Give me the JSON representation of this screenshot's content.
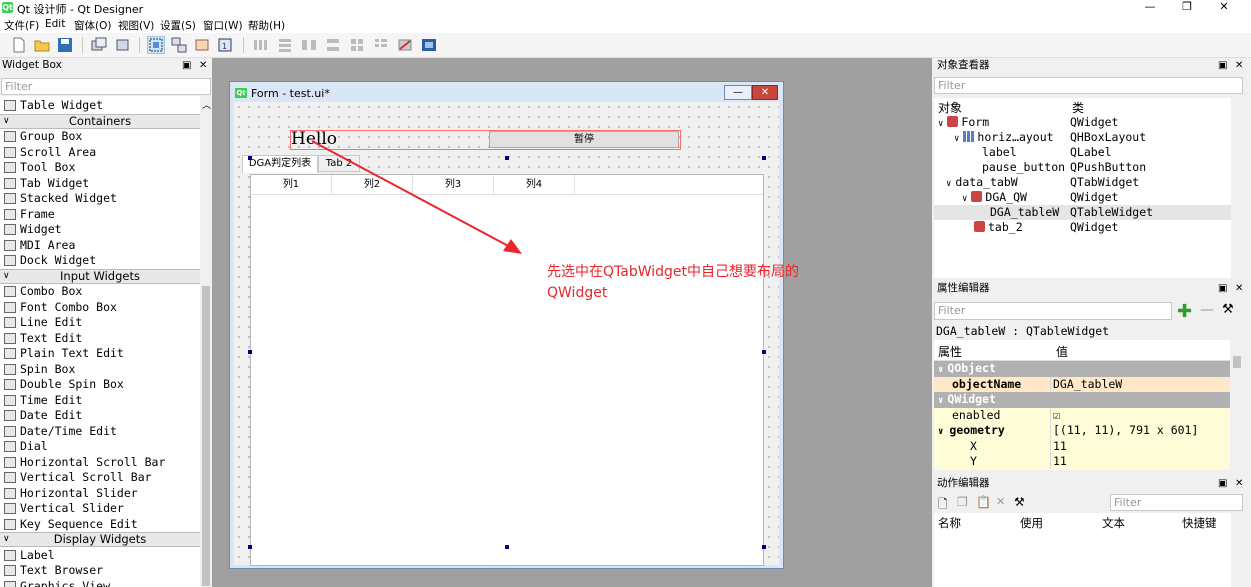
{
  "window": {
    "title": "Qt 设计师 - Qt Designer",
    "app_icon_text": "Qt"
  },
  "menu": [
    "文件(F)",
    "Edit",
    "窗体(O)",
    "视图(V)",
    "设置(S)",
    "窗口(W)",
    "帮助(H)"
  ],
  "widget_box": {
    "title": "Widget Box",
    "filter_placeholder": "Filter",
    "items": [
      {
        "type": "item",
        "label": "Table Widget"
      },
      {
        "type": "cat",
        "label": "Containers"
      },
      {
        "type": "item",
        "label": "Group Box"
      },
      {
        "type": "item",
        "label": "Scroll Area"
      },
      {
        "type": "item",
        "label": "Tool Box"
      },
      {
        "type": "item",
        "label": "Tab Widget"
      },
      {
        "type": "item",
        "label": "Stacked Widget"
      },
      {
        "type": "item",
        "label": "Frame"
      },
      {
        "type": "item",
        "label": "Widget"
      },
      {
        "type": "item",
        "label": "MDI Area"
      },
      {
        "type": "item",
        "label": "Dock Widget"
      },
      {
        "type": "cat",
        "label": "Input Widgets"
      },
      {
        "type": "item",
        "label": "Combo Box"
      },
      {
        "type": "item",
        "label": "Font Combo Box"
      },
      {
        "type": "item",
        "label": "Line Edit"
      },
      {
        "type": "item",
        "label": "Text Edit"
      },
      {
        "type": "item",
        "label": "Plain Text Edit"
      },
      {
        "type": "item",
        "label": "Spin Box"
      },
      {
        "type": "item",
        "label": "Double Spin Box"
      },
      {
        "type": "item",
        "label": "Time Edit"
      },
      {
        "type": "item",
        "label": "Date Edit"
      },
      {
        "type": "item",
        "label": "Date/Time Edit"
      },
      {
        "type": "item",
        "label": "Dial"
      },
      {
        "type": "item",
        "label": "Horizontal Scroll Bar"
      },
      {
        "type": "item",
        "label": "Vertical Scroll Bar"
      },
      {
        "type": "item",
        "label": "Horizontal Slider"
      },
      {
        "type": "item",
        "label": "Vertical Slider"
      },
      {
        "type": "item",
        "label": "Key Sequence Edit"
      },
      {
        "type": "cat",
        "label": "Display Widgets"
      },
      {
        "type": "item",
        "label": "Label"
      },
      {
        "type": "item",
        "label": "Text Browser"
      },
      {
        "type": "item",
        "label": "Graphics View"
      }
    ]
  },
  "form": {
    "title": "Form - test.ui*",
    "label_text": "Hello",
    "pause_button": "暂停",
    "tabs": [
      "DGA判定列表",
      "Tab 2"
    ],
    "columns": [
      "列1",
      "列2",
      "列3",
      "列4"
    ]
  },
  "annotation": {
    "line1": "先选中在QTabWidget中自己想要布局的",
    "line2": "QWidget"
  },
  "object_inspector": {
    "title": "对象查看器",
    "filter_placeholder": "Filter",
    "col_object": "对象",
    "col_class": "类",
    "rows": [
      {
        "name": "Form",
        "cls": "QWidget",
        "indent": 0,
        "arrow": "∨",
        "icon": "form"
      },
      {
        "name": "horiz…ayout",
        "cls": "QHBoxLayout",
        "indent": 1,
        "arrow": "∨",
        "icon": "layout"
      },
      {
        "name": "label",
        "cls": "QLabel",
        "indent": 2,
        "arrow": "",
        "icon": ""
      },
      {
        "name": "pause_button",
        "cls": "QPushButton",
        "indent": 2,
        "arrow": "",
        "icon": ""
      },
      {
        "name": "data_tabW",
        "cls": "QTabWidget",
        "indent": 0.5,
        "arrow": "∨",
        "icon": ""
      },
      {
        "name": "DGA_QW",
        "cls": "QWidget",
        "indent": 1.5,
        "arrow": "∨",
        "icon": "form"
      },
      {
        "name": "DGA_tableW",
        "cls": "QTableWidget",
        "indent": 2.5,
        "arrow": "",
        "icon": "",
        "selected": true
      },
      {
        "name": "tab_2",
        "cls": "QWidget",
        "indent": 1.5,
        "arrow": "",
        "icon": "form"
      }
    ]
  },
  "property_editor": {
    "title": "属性编辑器",
    "filter_placeholder": "Filter",
    "subject": "DGA_tableW : QTableWidget",
    "col_prop": "属性",
    "col_value": "值",
    "rows": [
      {
        "k": "QObject",
        "v": "",
        "kind": "cat"
      },
      {
        "k": "objectName",
        "v": "DGA_tableW",
        "kind": "orange",
        "bold": true
      },
      {
        "k": "QWidget",
        "v": "",
        "kind": "cat"
      },
      {
        "k": "enabled",
        "v": "☑",
        "kind": "yellow"
      },
      {
        "k": "geometry",
        "v": "[(11, 11), 791 x 601]",
        "kind": "yellow",
        "bold": true,
        "arrow": "∨"
      },
      {
        "k": "X",
        "v": "11",
        "kind": "yellow",
        "sub": true
      },
      {
        "k": "Y",
        "v": "11",
        "kind": "yellow",
        "sub": true
      }
    ]
  },
  "action_editor": {
    "title": "动作编辑器",
    "filter_placeholder": "Filter",
    "cols": [
      "名称",
      "使用",
      "文本",
      "快捷键"
    ]
  },
  "colors": {
    "accent_red": "#e8262d",
    "qt_green": "#41cd52",
    "selection": "#e5e5e5"
  }
}
